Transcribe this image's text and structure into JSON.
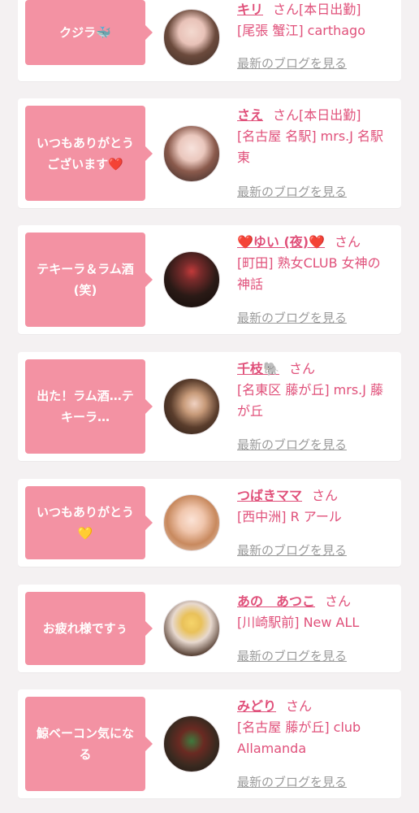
{
  "entries": [
    {
      "message": "クジラ🐳",
      "name": "キリ",
      "san": "さん[本日出勤]",
      "shop": "[尾張 蟹江] carthago",
      "blog": "最新のブログを見る"
    },
    {
      "message": "いつもありがとうございます❤️",
      "name": "さえ",
      "san": "さん[本日出勤]",
      "shop": "[名古屋 名駅] mrs.J 名駅東",
      "blog": "最新のブログを見る"
    },
    {
      "message": "テキーラ＆ラム酒(笑)",
      "name": "❤️ゆい (夜)❤️",
      "san": "さん",
      "shop": "[町田] 熟女CLUB 女神の神話",
      "blog": "最新のブログを見る"
    },
    {
      "message": "出た！ラム酒…テキーラ…",
      "name": "千枝🐘",
      "san": "さん",
      "shop": "[名東区 藤が丘] mrs.J 藤が丘",
      "blog": "最新のブログを見る"
    },
    {
      "message": "いつもありがとう💛",
      "name": "つばきママ",
      "san": "さん",
      "shop": "[西中洲] R アール",
      "blog": "最新のブログを見る"
    },
    {
      "message": "お疲れ様ですぅ",
      "name": "あの　あつこ",
      "san": "さん",
      "shop": "[川崎駅前] New ALL",
      "blog": "最新のブログを見る"
    },
    {
      "message": "鯨ベーコン気になる",
      "name": "みどり",
      "san": "さん",
      "shop": "[名古屋 藤が丘] club Allamanda",
      "blog": "最新のブログを見る"
    }
  ],
  "colors": {
    "accent_pink": "#f392a3",
    "name_pink": "#e0507a",
    "link_gray": "#9b9b9b",
    "background": "#f4f1f2"
  },
  "icons": [
    "avatar-photo"
  ]
}
